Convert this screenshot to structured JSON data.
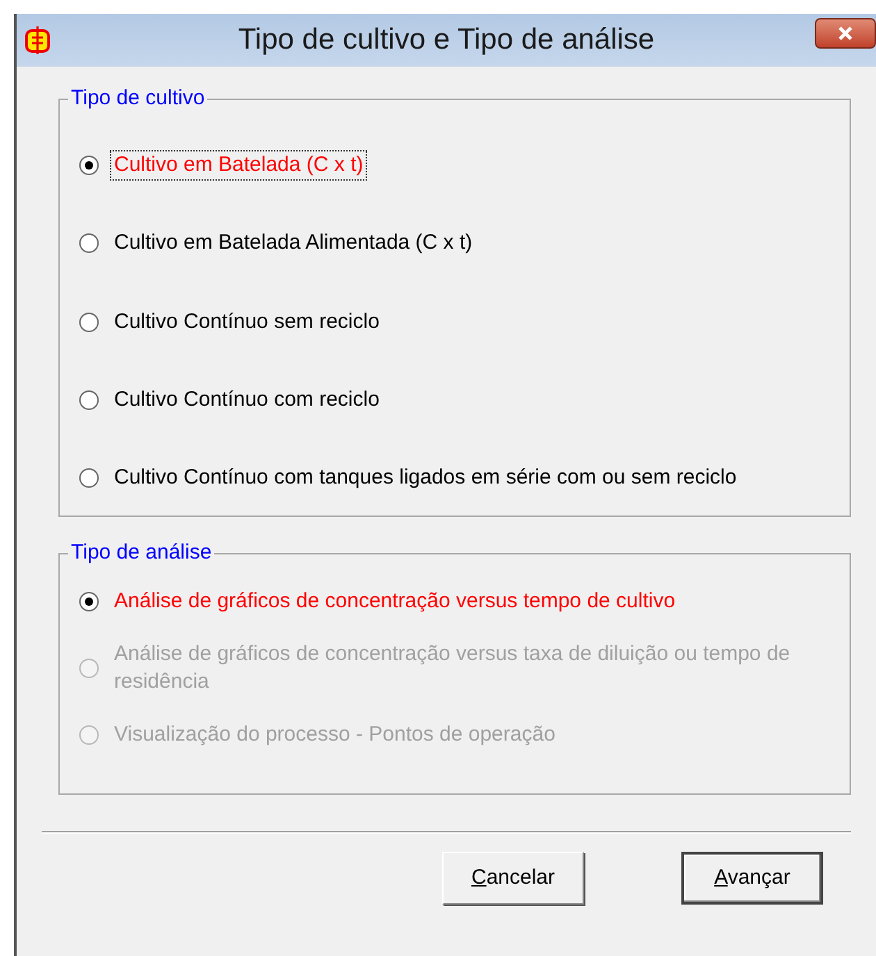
{
  "window": {
    "title": "Tipo de cultivo e Tipo de análise"
  },
  "groups": [
    {
      "title": "Tipo de cultivo",
      "options": [
        {
          "label": "Cultivo em Batelada (C x t)",
          "selected": true,
          "disabled": false,
          "focused": true
        },
        {
          "label": "Cultivo em Batelada Alimentada (C x t)",
          "selected": false,
          "disabled": false,
          "focused": false
        },
        {
          "label": "Cultivo Contínuo sem reciclo",
          "selected": false,
          "disabled": false,
          "focused": false
        },
        {
          "label": "Cultivo Contínuo com reciclo",
          "selected": false,
          "disabled": false,
          "focused": false
        },
        {
          "label": "Cultivo Contínuo com tanques ligados em série com ou sem reciclo",
          "selected": false,
          "disabled": false,
          "focused": false
        }
      ]
    },
    {
      "title": "Tipo de análise",
      "options": [
        {
          "label": "Análise de gráficos de concentração versus tempo de cultivo",
          "selected": true,
          "disabled": false,
          "focused": false
        },
        {
          "label": "Análise de gráficos de concentração versus taxa de diluição ou tempo de residência",
          "selected": false,
          "disabled": true,
          "focused": false
        },
        {
          "label": "Visualização do processo - Pontos de operação",
          "selected": false,
          "disabled": true,
          "focused": false
        }
      ]
    }
  ],
  "buttons": [
    {
      "label": "Cancelar",
      "default": false
    },
    {
      "label": "Avançar",
      "default": true
    }
  ]
}
